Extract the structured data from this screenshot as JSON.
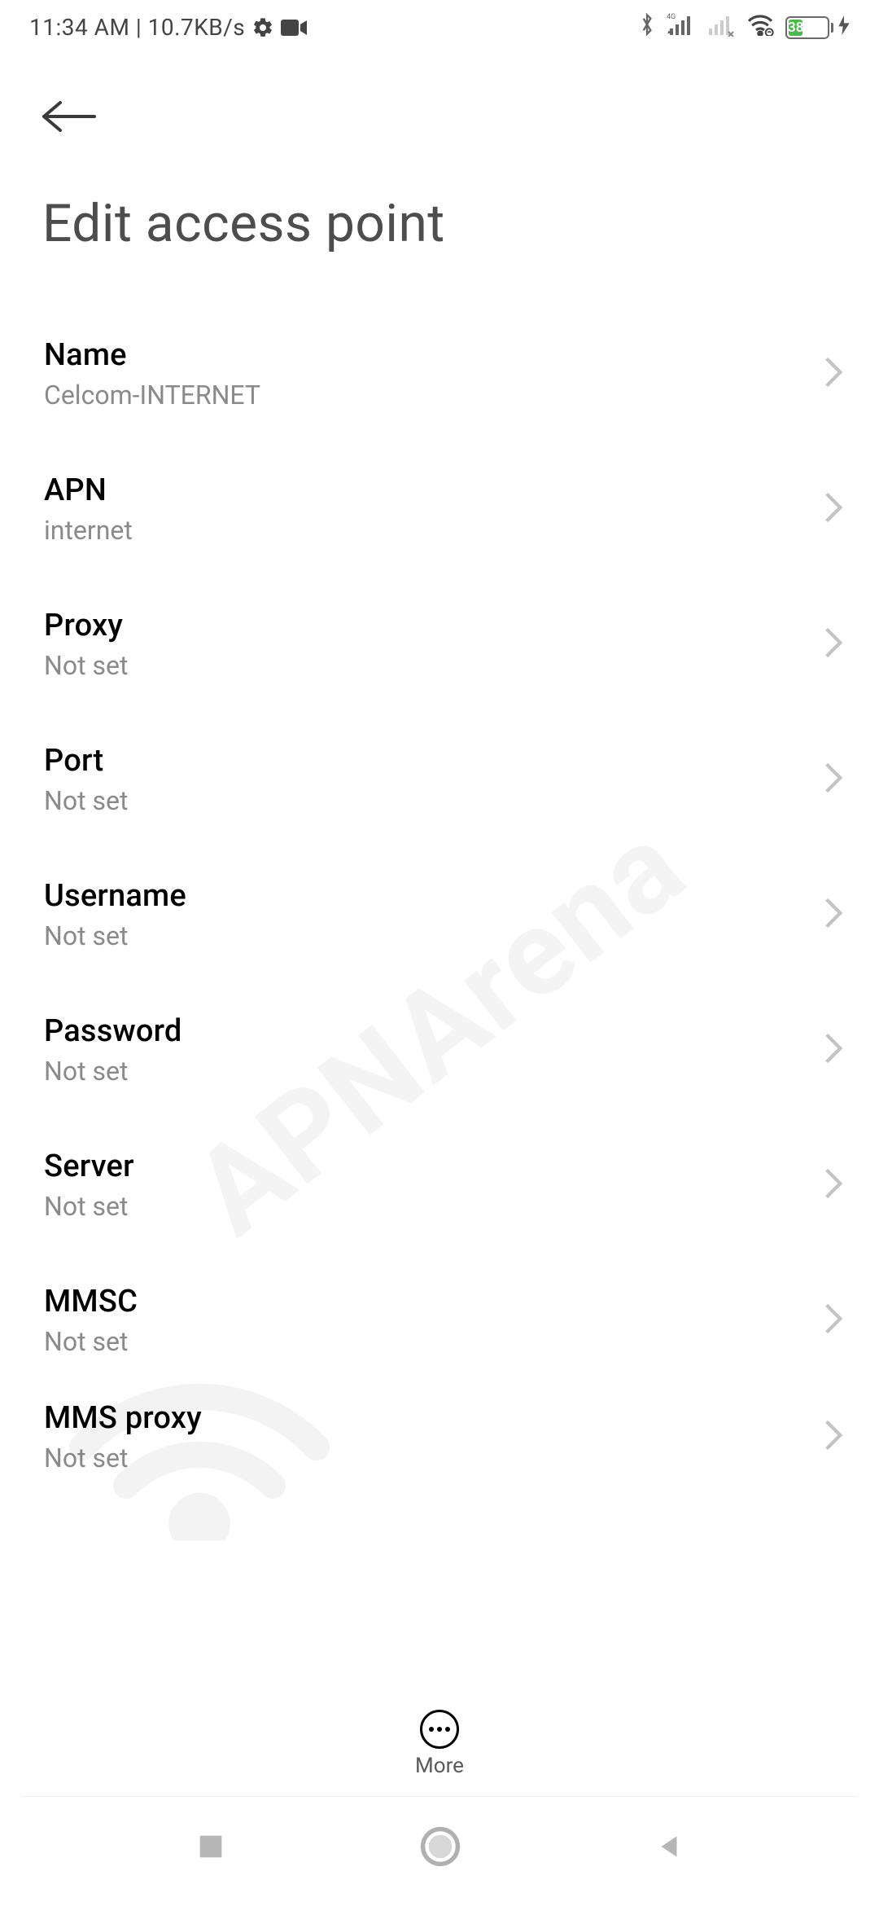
{
  "status": {
    "time_text": "11:34 AM | 10.7KB/s",
    "battery_pct": "38"
  },
  "page": {
    "title": "Edit access point"
  },
  "fields": [
    {
      "label": "Name",
      "value": "Celcom-INTERNET"
    },
    {
      "label": "APN",
      "value": "internet"
    },
    {
      "label": "Proxy",
      "value": "Not set"
    },
    {
      "label": "Port",
      "value": "Not set"
    },
    {
      "label": "Username",
      "value": "Not set"
    },
    {
      "label": "Password",
      "value": "Not set"
    },
    {
      "label": "Server",
      "value": "Not set"
    },
    {
      "label": "MMSC",
      "value": "Not set"
    },
    {
      "label": "MMS proxy",
      "value": "Not set"
    }
  ],
  "more": {
    "label": "More"
  },
  "watermark": {
    "text": "APNArena"
  }
}
